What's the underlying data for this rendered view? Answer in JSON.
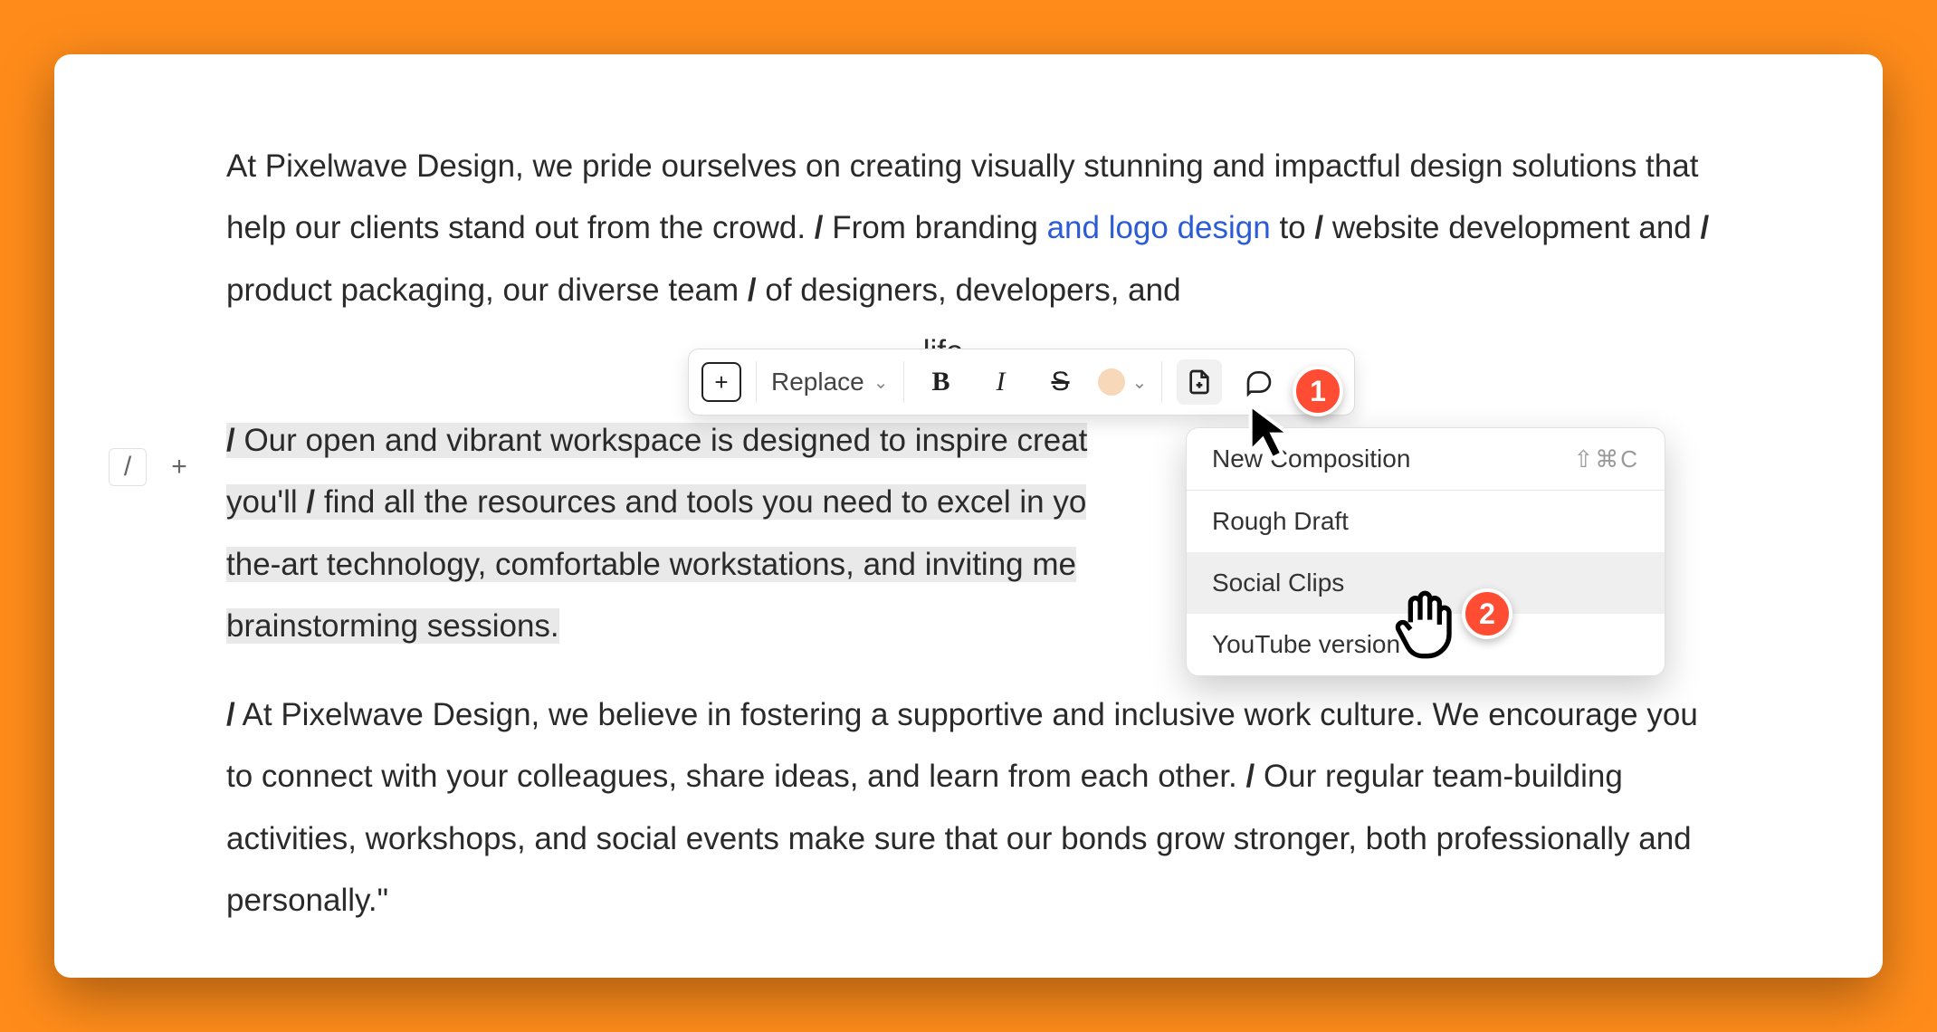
{
  "paragraphs": {
    "p1_a": "At Pixelwave Design, we pride ourselves on creating visually stunning and impactful design solutions that help our clients stand out from the crowd. ",
    "p1_b": " From branding",
    "p1_link": " and logo design ",
    "p1_c": "to ",
    "p1_d": " website development and ",
    "p1_e": " product packaging, our diverse team ",
    "p1_f": " of designers, developers, and ",
    "p1_g": " life.",
    "p2_a": " Our open and vibrant workspace is designed to inspire creat",
    "p2_b": "you'll ",
    "p2_c": " find all the resources and tools you need to excel in yo",
    "p2_d": "the-art technology, comfortable workstations, and inviting me",
    "p2_e": "brainstorming sessions.",
    "p3_a": " At Pixelwave Design, we believe in fostering a supportive and inclusive work culture. We encourage you to connect with your colleagues, share ideas, and learn from each other. ",
    "p3_b": " Our regular team-building activities, workshops, and social events make sure that our bonds grow stronger, both professionally and personally.\""
  },
  "slash": "/",
  "handles": {
    "slash": "/",
    "plus": "+"
  },
  "toolbar": {
    "add": "+",
    "replace": "Replace",
    "bold": "B",
    "italic": "I",
    "strike": "S"
  },
  "menu": {
    "new_comp": "New Composition",
    "new_comp_shortcut": "⇧⌘C",
    "rough_draft": "Rough Draft",
    "social_clips": "Social Clips",
    "youtube": "YouTube version"
  },
  "badges": {
    "one": "1",
    "two": "2"
  }
}
